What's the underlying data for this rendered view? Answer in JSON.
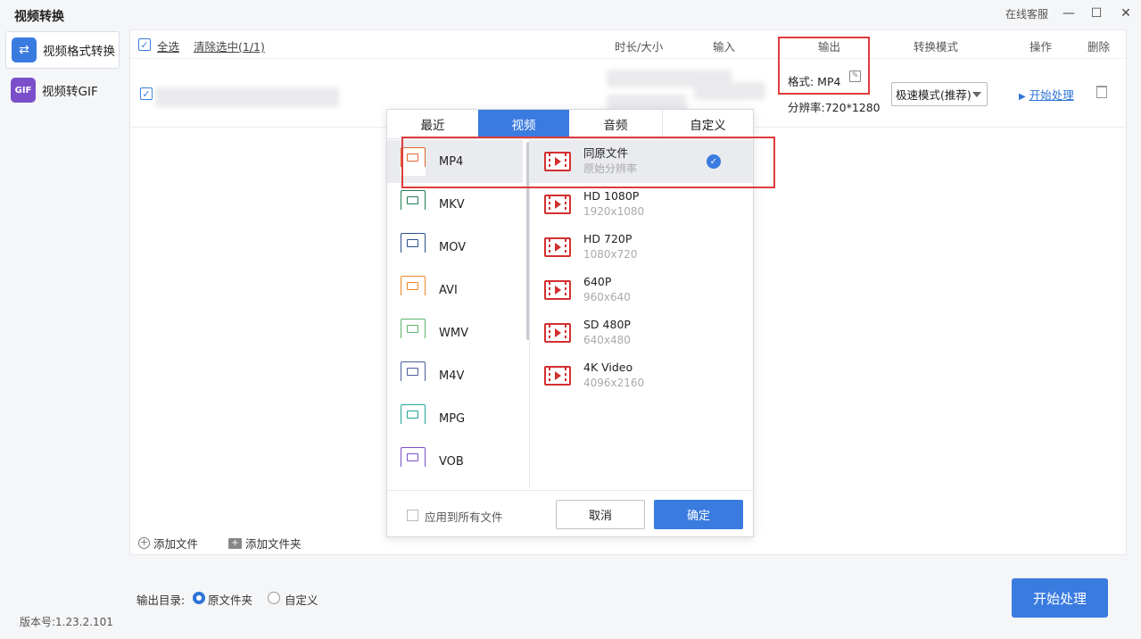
{
  "window": {
    "title": "视频转换",
    "support": "在线客服",
    "minimize": "—",
    "maximize": "☐",
    "close": "✕"
  },
  "sidebar": {
    "items": [
      {
        "label": "视频格式转换",
        "icon": "swap-arrows-icon",
        "icon_glyph": "⇄",
        "active": true
      },
      {
        "label": "视频转GIF",
        "icon": "gif-icon",
        "icon_glyph": "GIF",
        "active": false
      }
    ],
    "version": "版本号:1.23.2.101"
  },
  "list_header": {
    "select_all": "全选",
    "clear_selected": "清除选中(1/1)",
    "duration_size": "时长/大小",
    "input": "输入",
    "output": "输出",
    "convert_mode": "转换模式",
    "action": "操作",
    "delete": "删除"
  },
  "file_row": {
    "format_label": "格式: MP4",
    "resolution_label": "分辨率:720*1280",
    "mode_value": "极速模式(推荐)",
    "start_label": "开始处理"
  },
  "add": {
    "add_file": "添加文件",
    "add_folder": "添加文件夹"
  },
  "output_dir": {
    "label": "输出目录:",
    "options": [
      "原文件夹",
      "自定义"
    ],
    "selected": "原文件夹"
  },
  "start_button": "开始处理",
  "popup": {
    "tabs": [
      "最近",
      "视频",
      "音频",
      "自定义"
    ],
    "active_tab": "视频",
    "formats": [
      {
        "name": "MP4",
        "color": "#e0662b"
      },
      {
        "name": "MKV",
        "color": "#1e7d4f"
      },
      {
        "name": "MOV",
        "color": "#2c4f8c"
      },
      {
        "name": "AVI",
        "color": "#f08a24"
      },
      {
        "name": "WMV",
        "color": "#5bb36a"
      },
      {
        "name": "M4V",
        "color": "#4a5e9c"
      },
      {
        "name": "MPG",
        "color": "#1fa79a"
      },
      {
        "name": "VOB",
        "color": "#7a4fc9"
      }
    ],
    "selected_format": "MP4",
    "resolutions": [
      {
        "name": "同原文件",
        "sub": "原始分辨率"
      },
      {
        "name": "HD 1080P",
        "sub": "1920x1080"
      },
      {
        "name": "HD 720P",
        "sub": "1080x720"
      },
      {
        "name": "640P",
        "sub": "960x640"
      },
      {
        "name": "SD 480P",
        "sub": "640x480"
      },
      {
        "name": "4K Video",
        "sub": "4096x2160"
      }
    ],
    "selected_resolution": "同原文件",
    "apply_all": "应用到所有文件",
    "cancel": "取消",
    "ok": "确定"
  },
  "colors": {
    "accent": "#3a7be0",
    "highlight_box": "#e03b3b",
    "film_icon": "#d32f2f"
  }
}
